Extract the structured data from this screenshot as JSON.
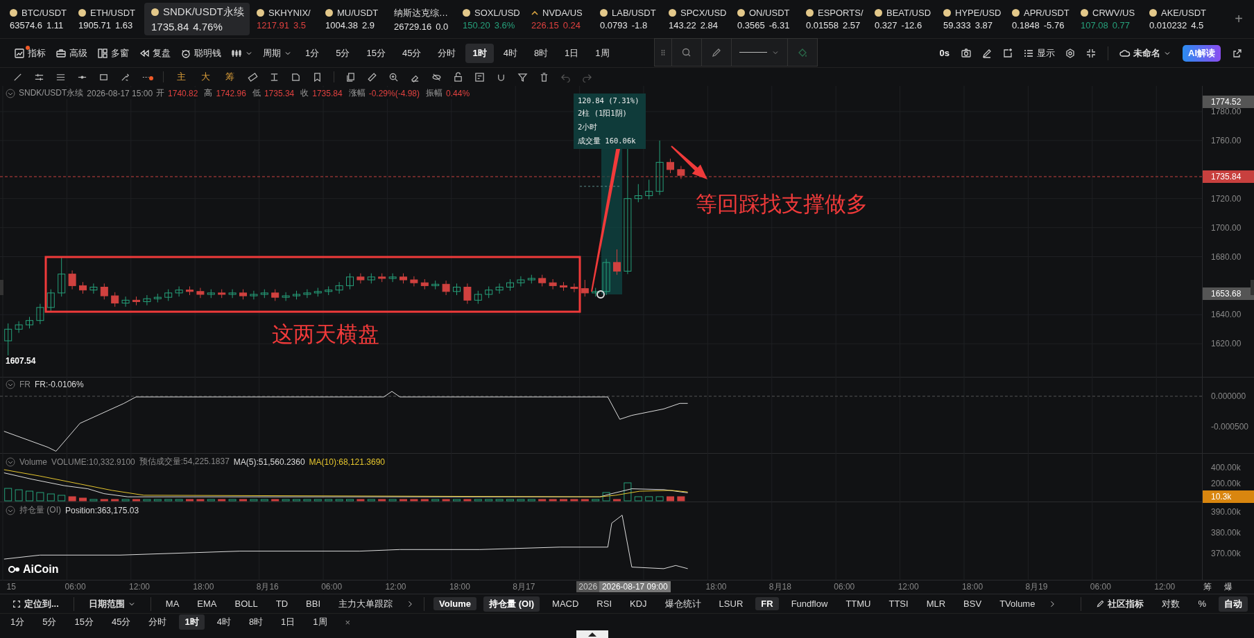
{
  "tickers": [
    {
      "symbol": "BTC/USDT",
      "price": "63574.6",
      "change": "1.11",
      "color": "#e6e6e6",
      "kind": "crypto",
      "selected": false
    },
    {
      "symbol": "ETH/USDT",
      "price": "1905.71",
      "change": "1.63",
      "color": "#e6e6e6",
      "kind": "crypto",
      "selected": false
    },
    {
      "symbol": "SNDK/USDT永续",
      "price": "1735.84",
      "change": "4.76%",
      "color": "#e6e6e6",
      "kind": "crypto",
      "selected": true
    },
    {
      "symbol": "SKHYNIX/",
      "price": "1217.91",
      "change": "3.5",
      "color": "#e0413f",
      "kind": "crypto",
      "selected": false
    },
    {
      "symbol": "MU/USDT",
      "price": "1004.38",
      "change": "2.9",
      "color": "#e6e6e6",
      "kind": "crypto",
      "selected": false
    },
    {
      "symbol": "纳斯达克综…",
      "price": "26729.16",
      "change": "0.0",
      "color": "#e6e6e6",
      "kind": "index",
      "selected": false
    },
    {
      "symbol": "SOXL/USD",
      "price": "150.20",
      "change": "3.6%",
      "color": "#26a17b",
      "kind": "crypto",
      "selected": false
    },
    {
      "symbol": "NVDA/US",
      "price": "226.15",
      "change": "0.24",
      "color": "#e0413f",
      "kind": "stock",
      "selected": false
    },
    {
      "symbol": "LAB/USDT",
      "price": "0.0793",
      "change": "-1.8",
      "color": "#e6e6e6",
      "kind": "crypto",
      "selected": false
    },
    {
      "symbol": "SPCX/USD",
      "price": "143.22",
      "change": "2.84",
      "color": "#e6e6e6",
      "kind": "crypto",
      "selected": false
    },
    {
      "symbol": "ON/USDT",
      "price": "0.3565",
      "change": "-6.31",
      "color": "#e6e6e6",
      "kind": "crypto",
      "selected": false
    },
    {
      "symbol": "ESPORTS/",
      "price": "0.01558",
      "change": "2.57",
      "color": "#e6e6e6",
      "kind": "crypto",
      "selected": false
    },
    {
      "symbol": "BEAT/USD",
      "price": "0.327",
      "change": "-12.6",
      "color": "#e6e6e6",
      "kind": "crypto",
      "selected": false
    },
    {
      "symbol": "HYPE/USD",
      "price": "59.333",
      "change": "3.87",
      "color": "#e6e6e6",
      "kind": "crypto",
      "selected": false
    },
    {
      "symbol": "APR/USDT",
      "price": "0.1848",
      "change": "-5.76",
      "color": "#e6e6e6",
      "kind": "crypto",
      "selected": false
    },
    {
      "symbol": "CRWV/US",
      "price": "107.08",
      "change": "0.77",
      "color": "#26a17b",
      "kind": "crypto",
      "selected": false
    },
    {
      "symbol": "AKE/USDT",
      "price": "0.010232",
      "change": "4.5",
      "color": "#e6e6e6",
      "kind": "crypto",
      "selected": false
    }
  ],
  "add_symbol": "+",
  "toolbar": {
    "tools": [
      {
        "label": "指标",
        "kind": "indicator",
        "badge": true
      },
      {
        "label": "高级",
        "kind": "advanced",
        "badge": false
      },
      {
        "label": "多窗",
        "kind": "windows",
        "badge": false
      },
      {
        "label": "复盘",
        "kind": "replay",
        "badge": false
      },
      {
        "label": "聪明钱",
        "kind": "smart",
        "badge": false
      }
    ],
    "period_label": "周期",
    "periods": [
      {
        "label": "1分",
        "selected": false
      },
      {
        "label": "5分",
        "selected": false
      },
      {
        "label": "15分",
        "selected": false
      },
      {
        "label": "45分",
        "selected": false
      },
      {
        "label": "分时",
        "selected": false
      },
      {
        "label": "1时",
        "selected": true
      },
      {
        "label": "4时",
        "selected": false
      },
      {
        "label": "8时",
        "selected": false
      },
      {
        "label": "1日",
        "selected": false
      },
      {
        "label": "1周",
        "selected": false
      }
    ],
    "timer": "0s",
    "display": "显示",
    "layout_name": "未命名",
    "ai_button": "AI解读"
  },
  "drawing_toolbar": {
    "text_tools": [
      "主",
      "大",
      "筹"
    ]
  },
  "legend": {
    "symbol": "SNDK/USDT永续",
    "time": "2026-08-17 15:00",
    "fields": [
      {
        "label": "开",
        "value": "1740.82"
      },
      {
        "label": "高",
        "value": "1742.96"
      },
      {
        "label": "低",
        "value": "1735.34"
      },
      {
        "label": "收",
        "value": "1735.84"
      },
      {
        "label": "涨幅",
        "value": "-0.29%(-4.98)"
      },
      {
        "label": "振幅",
        "value": "0.44%"
      }
    ]
  },
  "main_pane": {
    "price_axis": [
      "1780.00",
      "1760.00",
      "1720.00",
      "1700.00",
      "1680.00",
      "1640.00",
      "1620.00"
    ],
    "badges": [
      {
        "text": "1774.52",
        "kind": "high"
      },
      {
        "text": "1735.84",
        "kind": "last"
      },
      {
        "text": "1653.68",
        "kind": "low"
      }
    ],
    "low_label": "1607.54",
    "measure": [
      "120.84 (7.31%)",
      "2柱 (1阳1阴)",
      "2小时",
      "成交量 160.06k"
    ],
    "annotations": [
      {
        "text": "这两天横盘",
        "kind": "range"
      },
      {
        "text": "等回踩找支撑做多",
        "kind": "target"
      }
    ]
  },
  "fr_pane": {
    "name": "FR",
    "value": "FR:-0.0106%",
    "axis": [
      "0.000000",
      "-0.000500"
    ]
  },
  "volume_pane": {
    "name": "Volume",
    "value": "VOLUME:10,332.9100",
    "estimate": "预估成交量:54,225.1837",
    "ma5": "MA(5):51,560.2360",
    "ma10": "MA(10):68,121.3690",
    "axis": [
      "400.00k",
      "200.00k"
    ],
    "badge": "10.3k"
  },
  "oi_pane": {
    "name": "持仓量 (OI)",
    "value": "Position:363,175.03",
    "axis": [
      "390.00k",
      "380.00k",
      "370.00k"
    ],
    "logo": "AiCoin"
  },
  "time_axis": {
    "labels": [
      {
        "text": "15",
        "kind": "tick"
      },
      {
        "text": "06:00",
        "kind": "tick"
      },
      {
        "text": "12:00",
        "kind": "tick"
      },
      {
        "text": "18:00",
        "kind": "tick"
      },
      {
        "text": "8月16",
        "kind": "tick"
      },
      {
        "text": "06:00",
        "kind": "tick"
      },
      {
        "text": "12:00",
        "kind": "tick"
      },
      {
        "text": "18:00",
        "kind": "tick"
      },
      {
        "text": "8月17",
        "kind": "tick"
      },
      {
        "text": "2026",
        "kind": "stub"
      },
      {
        "text": "2026-08-17 09:00",
        "kind": "crosshair"
      },
      {
        "text": "18:00",
        "kind": "tick"
      },
      {
        "text": "8月18",
        "kind": "tick"
      },
      {
        "text": "06:00",
        "kind": "tick"
      },
      {
        "text": "12:00",
        "kind": "tick"
      },
      {
        "text": "18:00",
        "kind": "tick"
      },
      {
        "text": "8月19",
        "kind": "tick"
      },
      {
        "text": "06:00",
        "kind": "tick"
      },
      {
        "text": "12:00",
        "kind": "tick"
      }
    ],
    "corner": [
      "筹",
      "爆"
    ]
  },
  "bottom_bar": {
    "locate": "定位到...",
    "date_range": "日期范围",
    "main_indicators": [
      {
        "label": "MA",
        "selected": false
      },
      {
        "label": "EMA",
        "selected": false
      },
      {
        "label": "BOLL",
        "selected": false
      },
      {
        "label": "TD",
        "selected": false
      },
      {
        "label": "BBI",
        "selected": false
      },
      {
        "label": "主力大单跟踪",
        "selected": false
      }
    ],
    "sub_indicators": [
      {
        "label": "Volume",
        "selected": true
      },
      {
        "label": "持仓量 (OI)",
        "selected": true
      },
      {
        "label": "MACD",
        "selected": false
      },
      {
        "label": "RSI",
        "selected": false
      },
      {
        "label": "KDJ",
        "selected": false
      },
      {
        "label": "爆仓统计",
        "selected": false
      },
      {
        "label": "LSUR",
        "selected": false
      },
      {
        "label": "FR",
        "selected": true
      },
      {
        "label": "Fundflow",
        "selected": false
      },
      {
        "label": "TTMU",
        "selected": false
      },
      {
        "label": "TTSI",
        "selected": false
      },
      {
        "label": "MLR",
        "selected": false
      },
      {
        "label": "BSV",
        "selected": false
      },
      {
        "label": "TVolume",
        "selected": false
      }
    ],
    "community": "社区指标",
    "scale_options": [
      {
        "label": "对数",
        "selected": false
      },
      {
        "label": "%",
        "selected": false
      },
      {
        "label": "自动",
        "selected": true
      }
    ]
  },
  "period_bar": {
    "periods": [
      {
        "label": "1分",
        "selected": false
      },
      {
        "label": "5分",
        "selected": false
      },
      {
        "label": "15分",
        "selected": false
      },
      {
        "label": "45分",
        "selected": false
      },
      {
        "label": "分时",
        "selected": false
      },
      {
        "label": "1时",
        "selected": true
      },
      {
        "label": "4时",
        "selected": false
      },
      {
        "label": "8时",
        "selected": false
      },
      {
        "label": "1日",
        "selected": false
      },
      {
        "label": "1周",
        "selected": false
      }
    ],
    "close": "×"
  }
}
